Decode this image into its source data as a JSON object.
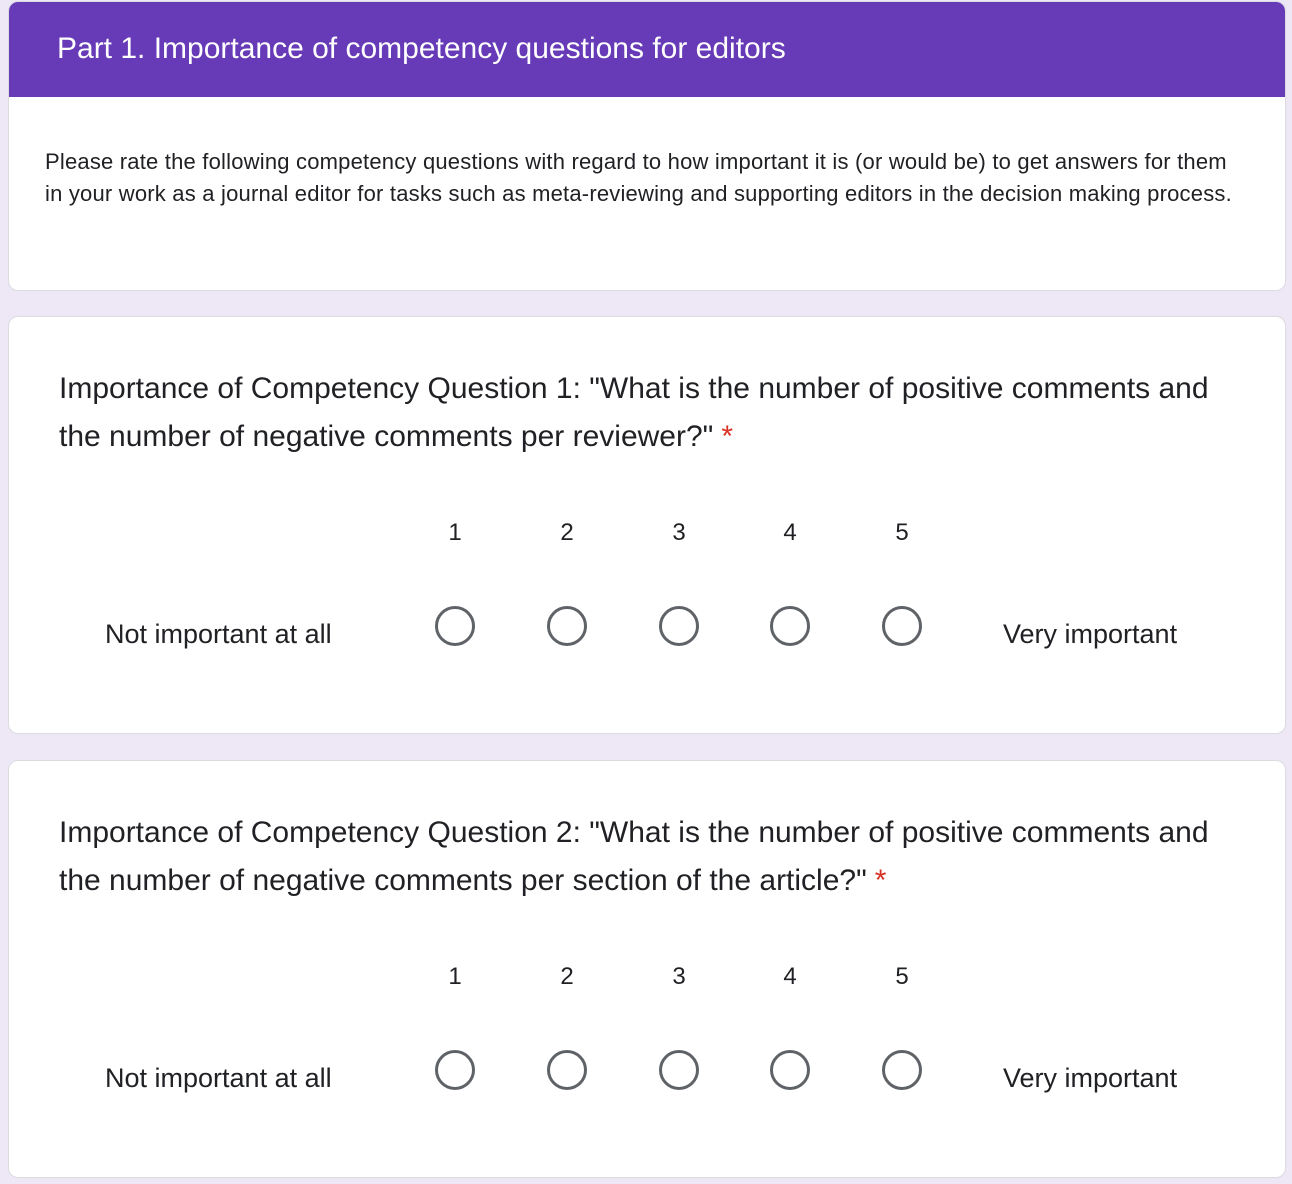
{
  "section": {
    "title": "Part 1. Importance of competency questions for editors",
    "description": "Please rate the following competency questions with regard to how important it is (or would be) to get answers for them in your work as a journal editor for tasks such as meta-reviewing and supporting editors in the decision making process."
  },
  "questions": [
    {
      "title": "Importance of Competency Question 1: \"What is the number of positive comments and the number of negative comments per reviewer?\"",
      "required_mark": "*",
      "scale": [
        "1",
        "2",
        "3",
        "4",
        "5"
      ],
      "low_label": "Not important at all",
      "high_label": "Very important"
    },
    {
      "title": "Importance of Competency Question 2: \"What is the number of positive comments and the number of negative comments per section of the article?\"",
      "required_mark": "*",
      "scale": [
        "1",
        "2",
        "3",
        "4",
        "5"
      ],
      "low_label": "Not important at all",
      "high_label": "Very important"
    }
  ],
  "colors": {
    "header": "#673ab7",
    "background": "#ede7f6",
    "required": "#d93025",
    "radio_border": "#5f6368"
  }
}
